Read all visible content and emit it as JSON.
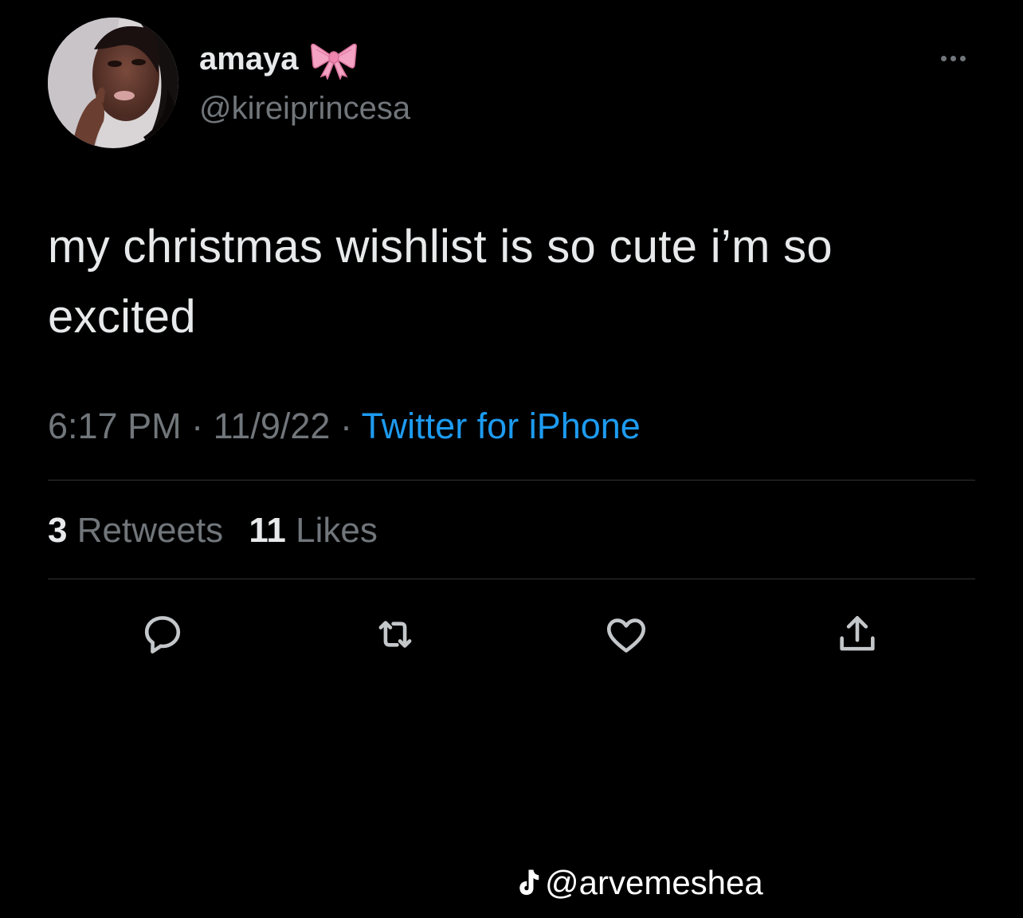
{
  "tweet": {
    "author": {
      "display_name": "amaya",
      "name_emoji": "ribbon-bow-emoji",
      "handle": "@kireiprincesa",
      "avatar": "profile-photo"
    },
    "text": "my christmas wishlist is so cute i’m so excited",
    "time": "6:17 PM",
    "date": "11/9/22",
    "separator": "·",
    "source": "Twitter for iPhone",
    "stats": {
      "retweets_count": "3",
      "retweets_label": "Retweets",
      "likes_count": "11",
      "likes_label": "Likes"
    },
    "actions": [
      "reply-icon",
      "retweet-icon",
      "like-icon",
      "share-icon"
    ]
  },
  "watermark": {
    "icon": "tiktok-icon",
    "text": "@arvemeshea"
  },
  "colors": {
    "background": "#000000",
    "text_primary": "#e7e9ea",
    "text_secondary": "#71767b",
    "link": "#1d9bf0",
    "divider": "#2f3336",
    "bow": "#f4a3c3"
  }
}
